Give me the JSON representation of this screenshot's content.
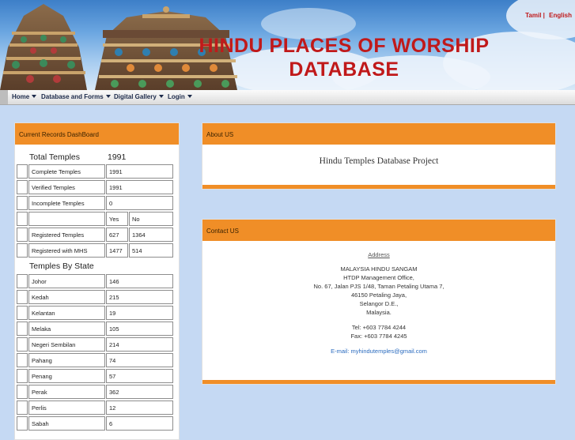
{
  "banner": {
    "title_line1": "HINDU PLACES OF WORSHIP",
    "title_line2": "DATABASE",
    "lang_tamil": "Tamil |",
    "lang_english": "English",
    "title_color": "#c0191a"
  },
  "menu": {
    "items": [
      {
        "label": "Home"
      },
      {
        "label": "Database and Forms"
      },
      {
        "label": "Digital Gallery"
      },
      {
        "label": "Login"
      }
    ]
  },
  "dashboard": {
    "header": "Current Records DashBoard",
    "total_label": "Total Temples",
    "total_value": "1991",
    "stats": [
      {
        "label": "Complete Temples",
        "a": "1991",
        "b": ""
      },
      {
        "label": "Verified Temples",
        "a": "1991",
        "b": ""
      },
      {
        "label": "Incomplete Temples",
        "a": "0",
        "b": ""
      },
      {
        "label": "",
        "a": "Yes",
        "b": "No"
      },
      {
        "label": "Registered Temples",
        "a": "627",
        "b": "1364"
      },
      {
        "label": "Registered with MHS",
        "a": "1477",
        "b": "514"
      }
    ],
    "state_heading": "Temples By State",
    "states": [
      {
        "name": "Johor",
        "count": "146"
      },
      {
        "name": "Kedah",
        "count": "215"
      },
      {
        "name": "Kelantan",
        "count": "19"
      },
      {
        "name": "Melaka",
        "count": "105"
      },
      {
        "name": "Negeri Sembilan",
        "count": "214"
      },
      {
        "name": "Pahang",
        "count": "74"
      },
      {
        "name": "Penang",
        "count": "57"
      },
      {
        "name": "Perak",
        "count": "362"
      },
      {
        "name": "Perlis",
        "count": "12"
      },
      {
        "name": "Sabah",
        "count": "6"
      }
    ]
  },
  "about": {
    "header": "About US",
    "text": "Hindu Temples Database Project"
  },
  "contact": {
    "header": "Contact US",
    "address_heading": "Address",
    "lines": [
      "MALAYSIA HINDU SANGAM",
      "HTDP Management Office,",
      "No. 67, Jalan PJS 1/48, Taman Petaling Utama 7,",
      "46150 Petaling Jaya,",
      "Selangor D.E.,",
      "Malaysia."
    ],
    "tel": "Tel: +603 7784 4244",
    "fax": "Fax: +603 7784 4245",
    "email": "E-mail: myhindutemples@gmail.com"
  },
  "colors": {
    "accent_orange": "#f08e27",
    "page_bg": "#c5d9f3",
    "link_blue": "#2a6bbf"
  }
}
